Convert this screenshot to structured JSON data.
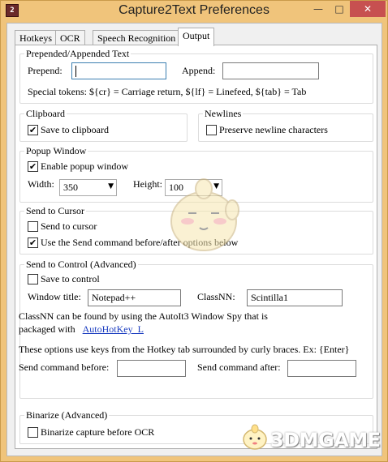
{
  "window": {
    "title": "Capture2Text Preferences",
    "icon_label": "2"
  },
  "tabs": [
    {
      "label": "Hotkeys",
      "active": false
    },
    {
      "label": "OCR",
      "active": false
    },
    {
      "label": "Speech Recognition",
      "active": false
    },
    {
      "label": "Output",
      "active": true
    }
  ],
  "prepended": {
    "title": "Prepended/Appended Text",
    "prepend_label": "Prepend:",
    "prepend_value": "",
    "append_label": "Append:",
    "append_value": "",
    "special_tokens": "Special tokens: ${cr} = Carriage return, ${lf} = Linefeed, ${tab} = Tab"
  },
  "clipboard": {
    "title": "Clipboard",
    "save_label": "Save to clipboard",
    "save_checked": true
  },
  "newlines": {
    "title": "Newlines",
    "preserve_label": "Preserve newline characters",
    "preserve_checked": false
  },
  "popup": {
    "title": "Popup Window",
    "enable_label": "Enable popup window",
    "enable_checked": true,
    "width_label": "Width:",
    "width_value": "350",
    "height_label": "Height:",
    "height_value": "100"
  },
  "send_cursor": {
    "title": "Send to Cursor",
    "send_label": "Send to cursor",
    "send_checked": false,
    "use_cmd_label": "Use the Send command before/after options below",
    "use_cmd_checked": true
  },
  "send_control": {
    "title": "Send to Control (Advanced)",
    "save_label": "Save to control",
    "save_checked": false,
    "window_title_label": "Window title:",
    "window_title_value": "Notepad++",
    "classnn_label": "ClassNN:",
    "classnn_value": "Scintilla1"
  },
  "info": {
    "line1": "ClassNN can be found by using the AutoIt3 Window Spy that is",
    "line2_prefix": "packaged with",
    "link": "AutoHotKey_L",
    "hotkey_note": "These options use keys from the Hotkey tab surrounded by curly braces. Ex: {Enter}",
    "before_label": "Send command before:",
    "before_value": "",
    "after_label": "Send command after:",
    "after_value": ""
  },
  "binarize": {
    "title": "Binarize (Advanced)",
    "label": "Binarize capture before OCR",
    "checked": false
  },
  "watermark": {
    "text": "3DMGAME"
  },
  "colors": {
    "titlebar": "#f0c47b",
    "close_button": "#c75050",
    "link": "#1a3cc0"
  }
}
